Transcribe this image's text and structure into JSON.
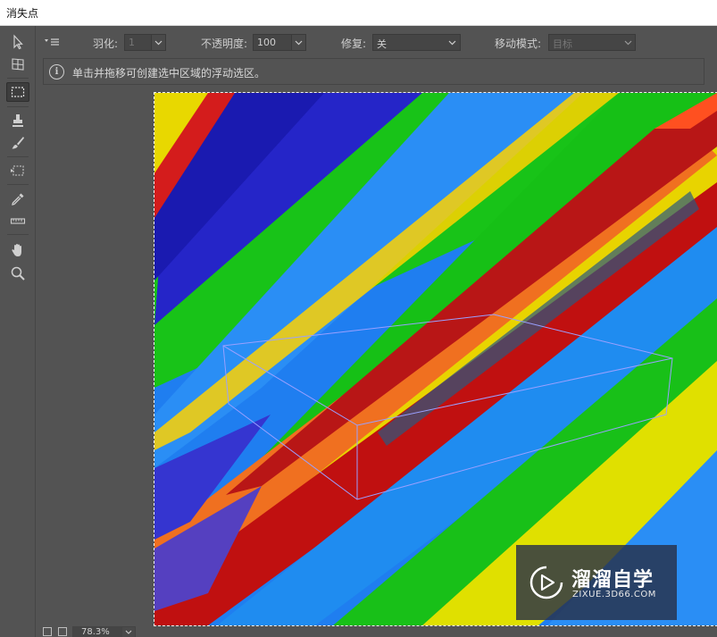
{
  "window": {
    "title": "消失点"
  },
  "tools": [
    {
      "name": "edit-plane-tool",
      "icon": "arrow-pointer-icon"
    },
    {
      "name": "create-plane-tool",
      "icon": "grid-plane-icon"
    },
    {
      "name": "marquee-tool",
      "icon": "dashed-rectangle-icon",
      "active": true
    },
    {
      "name": "stamp-tool",
      "icon": "stamp-icon"
    },
    {
      "name": "brush-tool",
      "icon": "brush-icon"
    },
    {
      "name": "transform-tool",
      "icon": "transform-icon"
    },
    {
      "name": "eyedropper-tool",
      "icon": "eyedropper-icon"
    },
    {
      "name": "measure-tool",
      "icon": "ruler-icon"
    },
    {
      "name": "hand-tool",
      "icon": "hand-icon"
    },
    {
      "name": "zoom-tool",
      "icon": "magnifier-icon"
    }
  ],
  "options": {
    "feather_label": "羽化:",
    "feather_value": "1",
    "opacity_label": "不透明度:",
    "opacity_value": "100",
    "heal_label": "修复:",
    "heal_value": "关",
    "move_mode_label": "移动模式:",
    "move_mode_value": "目标"
  },
  "info": {
    "text": "单击并拖移可创建选中区域的浮动选区。"
  },
  "status": {
    "zoom": "78.3%"
  },
  "watermark": {
    "title": "溜溜自学",
    "url": "ZIXUE.3D66.COM"
  },
  "colors": {
    "panel": "#535353",
    "field": "#454545",
    "selection": "#9aa0ff"
  }
}
